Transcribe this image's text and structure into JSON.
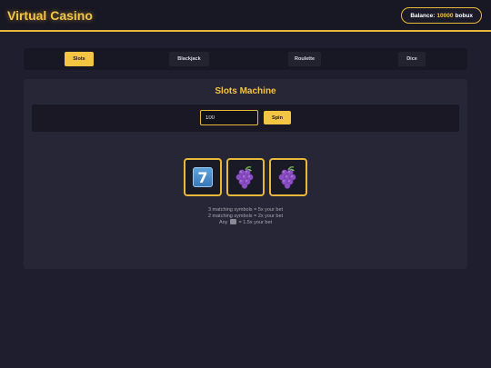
{
  "header": {
    "title": "Virtual Casino",
    "balance_label": "Balance:",
    "balance_amount": "10000",
    "balance_unit": "bobux"
  },
  "tabs": [
    {
      "label": "Slots",
      "active": true
    },
    {
      "label": "Blackjack",
      "active": false
    },
    {
      "label": "Roulette",
      "active": false
    },
    {
      "label": "Dice",
      "active": false
    }
  ],
  "slots": {
    "title": "Slots Machine",
    "bet_value": "100",
    "spin_label": "Spin",
    "reels": [
      {
        "symbol": "seven-icon"
      },
      {
        "symbol": "grapes-icon"
      },
      {
        "symbol": "grapes-icon"
      }
    ],
    "payout": {
      "line1": "3 matching symbols = 5x your bet",
      "line2": "2 matching symbols = 2x your bet",
      "line3_prefix": "Any",
      "line3_suffix": "= 1.5x your bet"
    }
  },
  "colors": {
    "accent": "#f4c443",
    "background": "#1f1e2e",
    "panel": "#272636"
  }
}
